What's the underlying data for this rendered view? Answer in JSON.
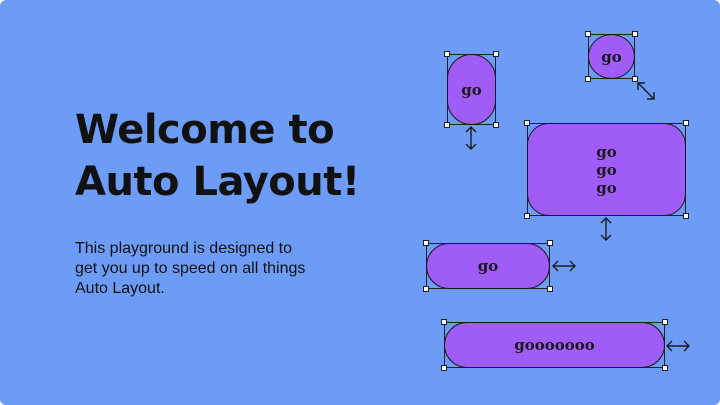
{
  "headline": {
    "line1": "Welcome to",
    "line2": "Auto Layout!"
  },
  "intro": {
    "line1": "This playground is designed to",
    "line2": "get you up to speed on all things",
    "line3": "Auto Layout."
  },
  "demos": {
    "vertical_pill": {
      "label": "go",
      "resize_icon": "vertical-resize-arrow"
    },
    "circle_button": {
      "label": "go",
      "resize_icon": "diagonal-resize-arrow"
    },
    "stack_box": {
      "labels": [
        "go",
        "go",
        "go"
      ],
      "resize_icon": "vertical-resize-arrow"
    },
    "horizontal_pill": {
      "label": "go",
      "resize_icon": "horizontal-resize-arrow"
    },
    "wide_pill": {
      "label": "gooooooo",
      "resize_icon": "horizontal-resize-arrow"
    }
  },
  "colors": {
    "background": "#6c9cf5",
    "pill_fill": "#a05cf7",
    "ink": "#111111"
  }
}
